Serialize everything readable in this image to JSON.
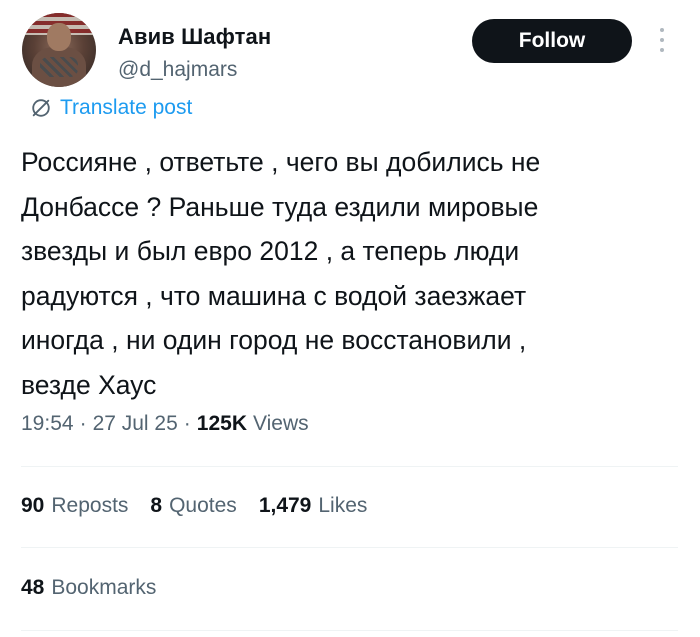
{
  "author": {
    "display_name": "Авив Шафтан",
    "handle": "@d_hajmars",
    "avatar_icon": "profile-photo"
  },
  "actions": {
    "follow_label": "Follow",
    "more_icon": "vertical-ellipsis-icon"
  },
  "translate": {
    "label": "Translate post",
    "icon": "translate-globe-icon",
    "color": "#1d9bf0"
  },
  "post": {
    "text": "Россияне , ответьте , чего вы добились не\nДонбассе ? Раньше туда ездили мировые\nзвезды и был евро 2012 , а теперь люди\nрадуются , что машина с водой заезжает\nиногда , ни один город не восстановили ,\nвезде Хаус"
  },
  "meta": {
    "time": "19:54",
    "separator": "·",
    "date": "27 Jul 25",
    "views_count": "125K",
    "views_label": "Views"
  },
  "stats": {
    "reposts_count": "90",
    "reposts_label": "Reposts",
    "quotes_count": "8",
    "quotes_label": "Quotes",
    "likes_count": "1,479",
    "likes_label": "Likes",
    "bookmarks_count": "48",
    "bookmarks_label": "Bookmarks"
  },
  "colors": {
    "text_primary": "#0f1419",
    "text_secondary": "#536471",
    "link": "#1d9bf0",
    "follow_bg": "#0f1419",
    "divider": "#eff3f4"
  }
}
